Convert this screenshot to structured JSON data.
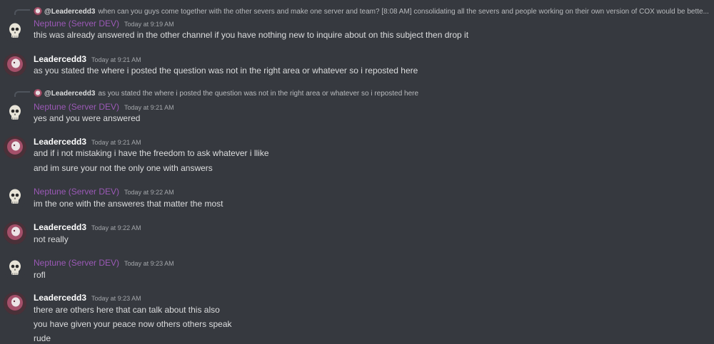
{
  "messages": [
    {
      "author": "Neptune (Server DEV)",
      "timestamp": "Today at 9:19 AM",
      "avatar": "skull-avatar",
      "reply": {
        "author": "@Leadercedd3",
        "text": "when can you guys come together with the other severs and make one server and team? [8:08 AM] consolidating all the severs and people working on their own version of COX would be bette..."
      },
      "lines": [
        "this was already answered in the other channel if you have nothing new to inquire about on this subject then drop it"
      ]
    },
    {
      "author": "Leadercedd3",
      "timestamp": "Today at 9:21 AM",
      "avatar": "leader-avatar",
      "lines": [
        "as you stated the where i posted the question was not in the right area or whatever so i reposted here"
      ]
    },
    {
      "author": "Neptune (Server DEV)",
      "timestamp": "Today at 9:21 AM",
      "avatar": "skull-avatar",
      "reply": {
        "author": "@Leadercedd3",
        "text": "as you stated the where i posted the question was not in the right area or whatever so i reposted here"
      },
      "lines": [
        "yes and you were answered"
      ]
    },
    {
      "author": "Leadercedd3",
      "timestamp": "Today at 9:21 AM",
      "avatar": "leader-avatar",
      "lines": [
        "and if i not mistaking i have the freedom to ask whatever i llike",
        "and im sure your not the only one with answers"
      ]
    },
    {
      "author": "Neptune (Server DEV)",
      "timestamp": "Today at 9:22 AM",
      "avatar": "skull-avatar",
      "lines": [
        "im the one with the answeres that matter the most"
      ]
    },
    {
      "author": "Leadercedd3",
      "timestamp": "Today at 9:22 AM",
      "avatar": "leader-avatar",
      "lines": [
        "not really"
      ]
    },
    {
      "author": "Neptune (Server DEV)",
      "timestamp": "Today at 9:23 AM",
      "avatar": "skull-avatar",
      "lines": [
        "rofl"
      ]
    },
    {
      "author": "Leadercedd3",
      "timestamp": "Today at 9:23 AM",
      "avatar": "leader-avatar",
      "lines": [
        "there are others here that can talk about this also",
        "you have given your peace now others others speak",
        "rude"
      ]
    }
  ]
}
